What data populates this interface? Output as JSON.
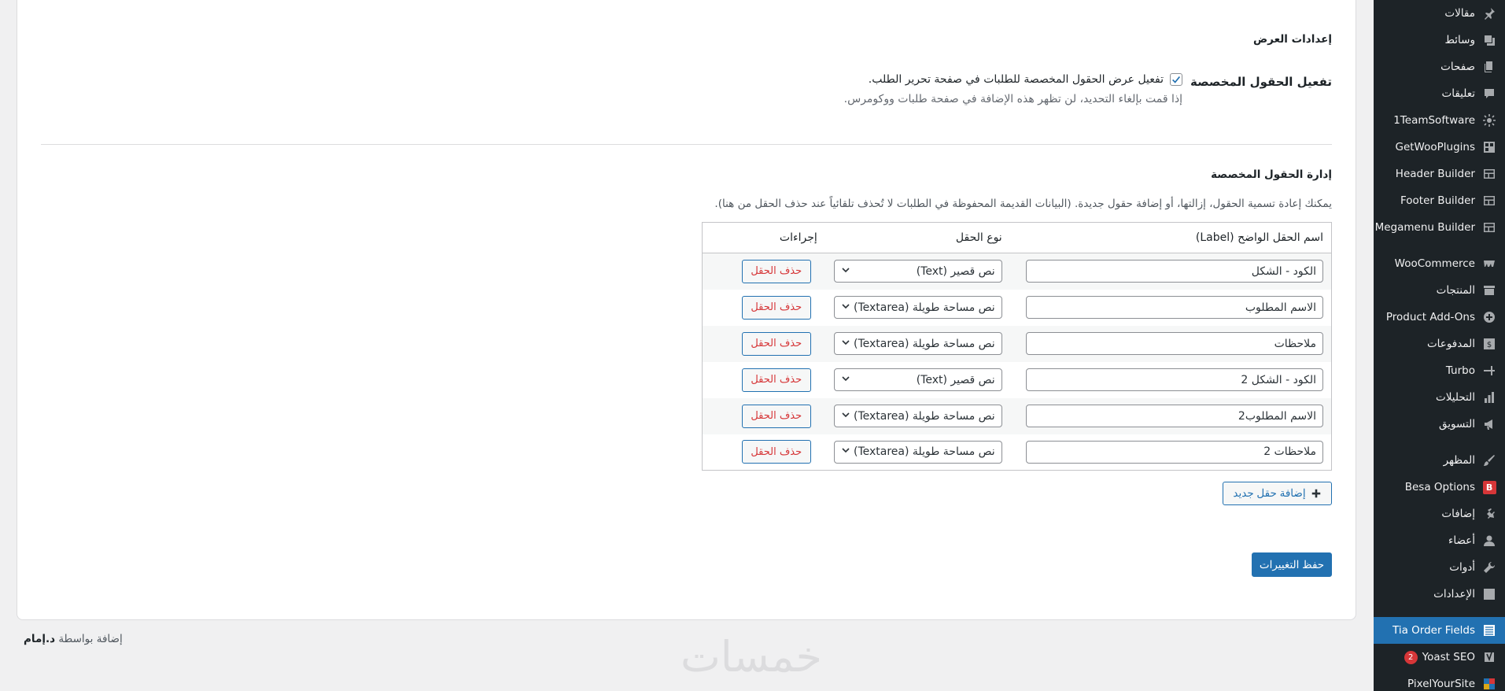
{
  "sidebar": {
    "items": [
      {
        "label": "مقالات",
        "icon": "pin-icon"
      },
      {
        "label": "وسائط",
        "icon": "media-icon"
      },
      {
        "label": "صفحات",
        "icon": "pages-icon"
      },
      {
        "label": "تعليقات",
        "icon": "comments-icon"
      },
      {
        "label": "1TeamSoftware",
        "icon": "gear-sun-icon"
      },
      {
        "label": "GetWooPlugins",
        "icon": "plugin-grid-icon"
      },
      {
        "label": "Header Builder",
        "icon": "layout-icon"
      },
      {
        "label": "Footer Builder",
        "icon": "layout-icon"
      },
      {
        "label": "Megamenu Builder",
        "icon": "layout-icon"
      },
      {
        "label": "WooCommerce",
        "icon": "woo-icon"
      },
      {
        "label": "المنتجات",
        "icon": "archive-icon"
      },
      {
        "label": "Product Add-Ons",
        "icon": "plus-circle-icon"
      },
      {
        "label": "المدفوعات",
        "icon": "dollar-icon"
      },
      {
        "label": "Turbo",
        "icon": "turbo-icon"
      },
      {
        "label": "التحليلات",
        "icon": "chart-bar-icon"
      },
      {
        "label": "التسويق",
        "icon": "megaphone-icon"
      },
      {
        "label": "المظهر",
        "icon": "brush-icon"
      },
      {
        "label": "Besa Options",
        "icon": "besa-b-icon"
      },
      {
        "label": "إضافات",
        "icon": "plugin-icon"
      },
      {
        "label": "أعضاء",
        "icon": "user-icon"
      },
      {
        "label": "أدوات",
        "icon": "wrench-icon"
      },
      {
        "label": "الإعدادات",
        "icon": "settings-grid-icon"
      },
      {
        "label": "Tia Order Fields",
        "icon": "list-icon",
        "current": true
      },
      {
        "label": "Yoast SEO",
        "icon": "yoast-icon",
        "badge": "2"
      },
      {
        "label": "PixelYourSite",
        "icon": "pixel-icon"
      }
    ],
    "besa_letter": "B",
    "accent": "#2271b1"
  },
  "display_settings": {
    "title": "إعدادات العرض",
    "field_label": "تفعيل الحقول المخصصة",
    "checkbox_label": "تفعيل عرض الحقول المخصصة للطلبات في صفحة تحرير الطلب.",
    "checked": true,
    "description": "إذا قمت بإلغاء التحديد، لن تظهر هذه الإضافة في صفحة طلبات ووكومرس."
  },
  "manage": {
    "title": "إدارة الحقول المخصصة",
    "description": "يمكنك إعادة تسمية الحقول، إزالتها، أو إضافة حقول جديدة. (البيانات القديمة المحفوظة في الطلبات لا تُحذف تلقائياً عند حذف الحقل من هنا).",
    "columns": {
      "label": "اسم الحقل الواضح (Label)",
      "type": "نوع الحقل",
      "actions": "إجراءات"
    },
    "rows": [
      {
        "label": "الكود - الشكل",
        "type": "نص قصير (Text)",
        "delete": "حذف الحقل"
      },
      {
        "label": "الاسم المطلوب",
        "type": "نص مساحة طويلة (Textarea)",
        "delete": "حذف الحقل"
      },
      {
        "label": "ملاحظات",
        "type": "نص مساحة طويلة (Textarea)",
        "delete": "حذف الحقل"
      },
      {
        "label": "الكود - الشكل 2",
        "type": "نص قصير (Text)",
        "delete": "حذف الحقل"
      },
      {
        "label": "الاسم المطلوب2",
        "type": "نص مساحة طويلة (Textarea)",
        "delete": "حذف الحقل"
      },
      {
        "label": "ملاحظات 2",
        "type": "نص مساحة طويلة (Textarea)",
        "delete": "حذف الحقل"
      }
    ],
    "add_button": "إضافة حقل جديد",
    "save_button": "حفظ التغييرات"
  },
  "footer": {
    "credit_prefix": "إضافة بواسطة",
    "credit_author": "د.إمام",
    "watermark": "خمسات"
  }
}
